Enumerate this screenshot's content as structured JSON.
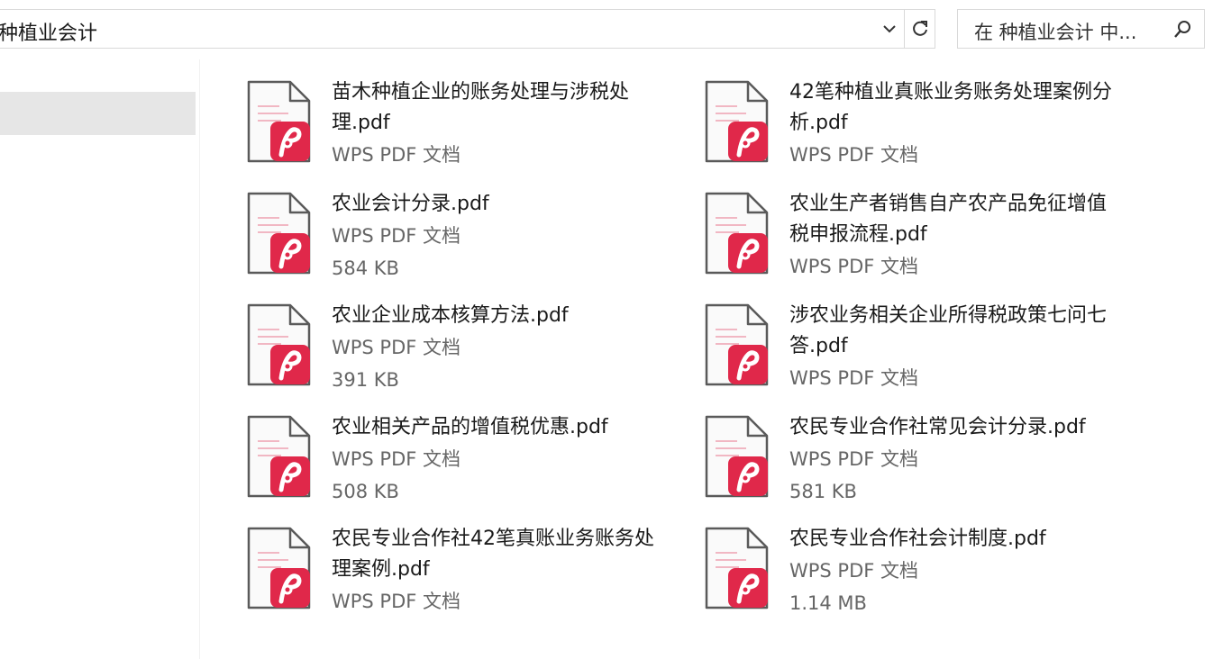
{
  "address_bar": {
    "path": "种植业会计"
  },
  "search": {
    "placeholder": "在 种植业会计 中..."
  },
  "files": [
    {
      "name": "苗木种植企业的账务处理与涉税处理.pdf",
      "type": "WPS PDF 文档",
      "size": ""
    },
    {
      "name": "42笔种植业真账业务账务处理案例分析.pdf",
      "type": "WPS PDF 文档",
      "size": ""
    },
    {
      "name": "农业会计分录.pdf",
      "type": "WPS PDF 文档",
      "size": "584 KB"
    },
    {
      "name": "农业生产者销售自产农产品免征增值税申报流程.pdf",
      "type": "WPS PDF 文档",
      "size": ""
    },
    {
      "name": "农业企业成本核算方法.pdf",
      "type": "WPS PDF 文档",
      "size": "391 KB"
    },
    {
      "name": "涉农业务相关企业所得税政策七问七答.pdf",
      "type": "WPS PDF 文档",
      "size": ""
    },
    {
      "name": "农业相关产品的增值税优惠.pdf",
      "type": "WPS PDF 文档",
      "size": "508 KB"
    },
    {
      "name": "农民专业合作社常见会计分录.pdf",
      "type": "WPS PDF 文档",
      "size": "581 KB"
    },
    {
      "name": "农民专业合作社42笔真账业务账务处理案例.pdf",
      "type": "WPS PDF 文档",
      "size": ""
    },
    {
      "name": "农民专业合作社会计制度.pdf",
      "type": "WPS PDF 文档",
      "size": "1.14 MB"
    }
  ],
  "colors": {
    "pdf_badge": "#e0284a",
    "selection": "#e6e6e6",
    "border": "#d9d9d9"
  },
  "icons": {
    "file": "pdf-file-icon",
    "search": "search-icon",
    "refresh": "refresh-icon",
    "dropdown": "chevron-down-icon"
  }
}
